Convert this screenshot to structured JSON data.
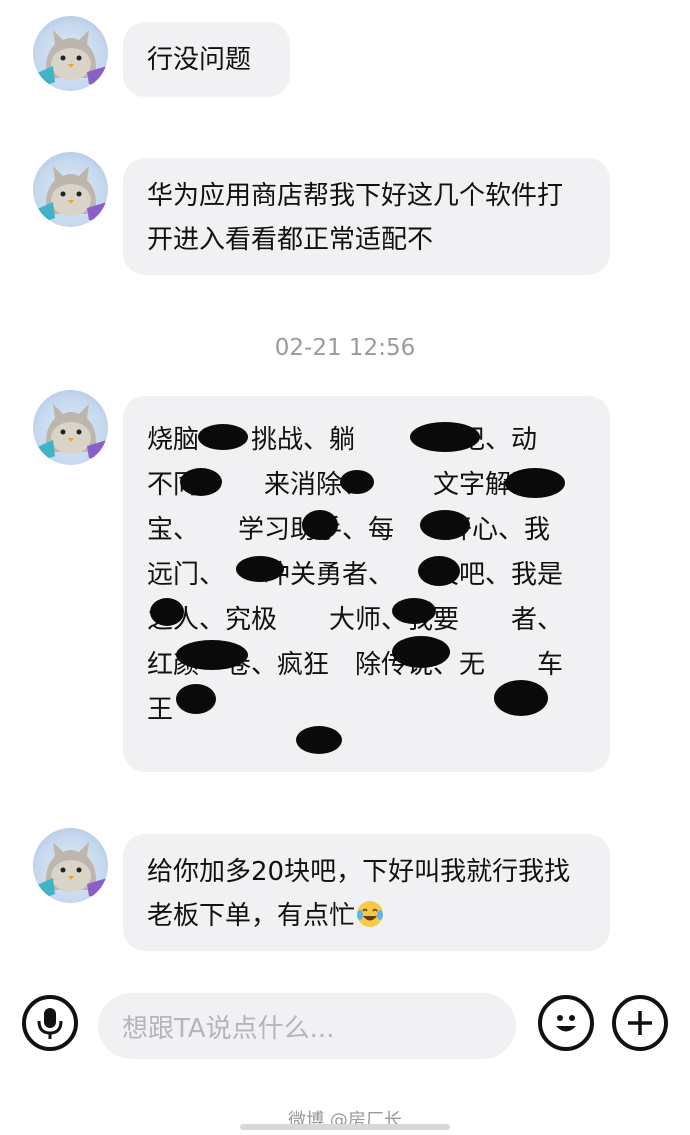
{
  "messages": [
    {
      "text": "行没问题"
    },
    {
      "text": "华为应用商店帮我下好这几个软件打开进入看看都正常适配不"
    },
    {
      "text": "烧脑　　挑战、躺　　　日记、动　　不同、　　来消除、　　　文字解谜、　　宝、　　学习助手、每　　开心、我　　远门、　　冲关勇者、　　关吧、我是　　之人、究极　　大师、我要　　者、红颜　卷、疯狂　除传说、无　　车王"
    },
    {
      "text": "给你加多20块吧，下好叫我就行我找老板下单，有点忙",
      "emoji": "crying-laughing-emoji"
    }
  ],
  "timestamp": "02-21 12:56",
  "input": {
    "placeholder": "想跟TA说点什么..."
  },
  "icons": {
    "mic": "microphone-icon",
    "emoji": "smiley-icon",
    "plus": "plus-icon"
  },
  "watermark": "微博 @房厂长"
}
